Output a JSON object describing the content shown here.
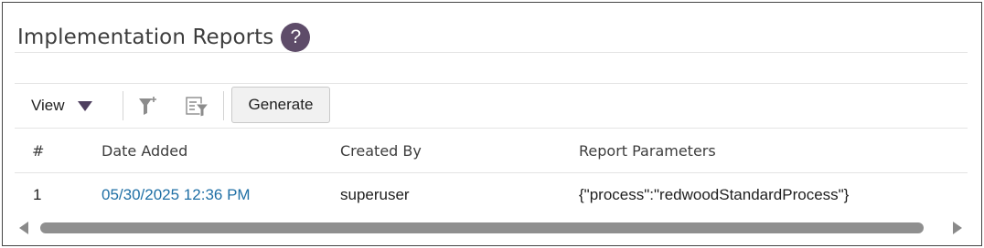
{
  "header": {
    "title": "Implementation Reports",
    "help_glyph": "?",
    "help_icon": "help-circle-icon"
  },
  "toolbar": {
    "view_label": "View",
    "view_caret_icon": "caret-down-icon",
    "add_filter_icon": "add-filter-icon",
    "filter_list_icon": "filter-list-icon",
    "generate_label": "Generate"
  },
  "table": {
    "columns": [
      "#",
      "Date Added",
      "Created By",
      "Report Parameters"
    ],
    "rows": [
      [
        "1",
        "05/30/2025 12:36 PM",
        "superuser",
        "{\"process\":\"redwoodStandardProcess\"}"
      ]
    ]
  },
  "colors": {
    "accent": "#5e4c69",
    "link": "#1f6fa5",
    "scroll_thumb": "#8f8f8f"
  }
}
